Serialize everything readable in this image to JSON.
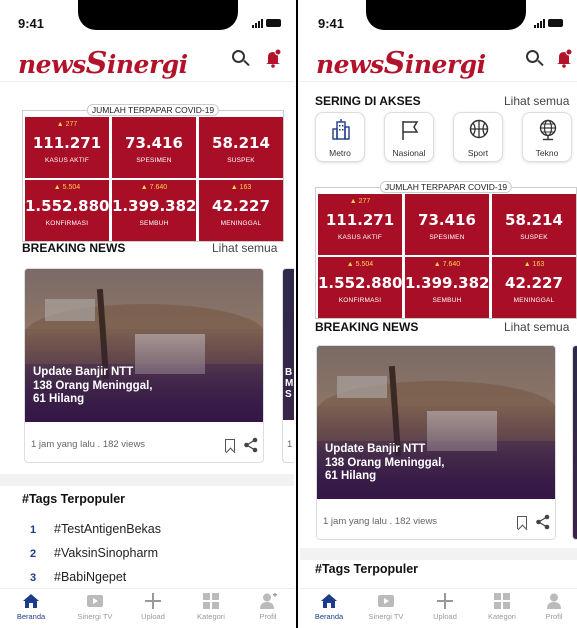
{
  "status": {
    "time": "9:41"
  },
  "brand": {
    "logo_lead": "news",
    "logo_cap": "S",
    "logo_tail": "inergi"
  },
  "colors": {
    "brand_red": "#a80f27",
    "accent_blue": "#1e3c8c",
    "delta_yellow": "#ffd34d"
  },
  "covid": {
    "caption": "JUMLAH TERPAPAR COVID-19",
    "stats": [
      {
        "delta": "277",
        "value": "111.271",
        "label": "KASUS AKTIF"
      },
      {
        "delta": "",
        "value": "73.416",
        "label": "SPESIMEN"
      },
      {
        "delta": "",
        "value": "58.214",
        "label": "SUSPEK"
      },
      {
        "delta": "5.504",
        "value": "1.552.880",
        "label": "KONFIRMASI"
      },
      {
        "delta": "7.640",
        "value": "1.399.382",
        "label": "SEMBUH"
      },
      {
        "delta": "163",
        "value": "42.227",
        "label": "MENINGGAL"
      }
    ]
  },
  "breaking": {
    "title": "BREAKING NEWS",
    "see_all": "Lihat semua",
    "card": {
      "headline": "Update Banjir NTT\n138 Orang Meninggal,\n61 Hilang",
      "meta": "1 jam yang lalu . 182 views"
    },
    "peek_text": "B\nM\nS",
    "peek_meta": "1"
  },
  "frequent": {
    "title": "SERING DI AKSES",
    "see_all": "Lihat semua",
    "categories": [
      {
        "label": "Metro",
        "icon": "building-icon"
      },
      {
        "label": "Nasional",
        "icon": "flag-icon"
      },
      {
        "label": "Sport",
        "icon": "basketball-icon"
      },
      {
        "label": "Tekno",
        "icon": "globe-icon"
      }
    ]
  },
  "tags": {
    "title": "#Tags Terpopuler",
    "items": [
      {
        "rank": "1",
        "tag": "#TestAntigenBekas"
      },
      {
        "rank": "2",
        "tag": "#VaksinSinopharm"
      },
      {
        "rank": "3",
        "tag": "#BabiNgepet"
      }
    ]
  },
  "nav": {
    "items": [
      {
        "label": "Beranda",
        "icon": "home-icon"
      },
      {
        "label": "Sinergi TV",
        "icon": "tv-icon"
      },
      {
        "label": "Upload",
        "icon": "plus-icon"
      },
      {
        "label": "Kategori",
        "icon": "grid-icon"
      },
      {
        "label": "Profil",
        "icon": "profile-icon"
      }
    ]
  }
}
